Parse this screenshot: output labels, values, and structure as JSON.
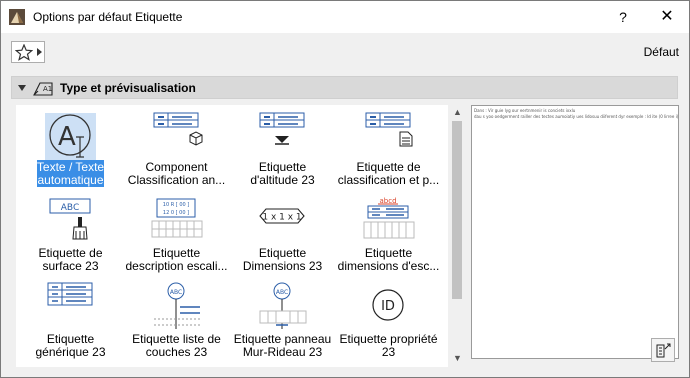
{
  "window": {
    "title": "Options par défaut Etiquette"
  },
  "title_buttons": {
    "help": "?",
    "close": "✕"
  },
  "toolbar": {
    "default_label": "Défaut"
  },
  "section": {
    "title": "Type et prévisualisation"
  },
  "tiles": [
    {
      "line1": "Texte / Texte",
      "line2": "automatique",
      "icon": "auto-text-icon",
      "selected": true
    },
    {
      "line1": "Component",
      "line2": "Classification an...",
      "icon": "component-classification-icon"
    },
    {
      "line1": "Etiquette",
      "line2": "d'altitude 23",
      "icon": "elevation-label-icon"
    },
    {
      "line1": "Etiquette de",
      "line2": "classification et p...",
      "icon": "classification-property-icon"
    },
    {
      "line1": "Etiquette de",
      "line2": "surface 23",
      "icon": "surface-label-icon"
    },
    {
      "line1": "Etiquette",
      "line2": "description escali...",
      "icon": "stair-description-icon"
    },
    {
      "line1": "Etiquette",
      "line2": "Dimensions 23",
      "icon": "dimensions-label-icon"
    },
    {
      "line1": "Etiquette",
      "line2": "dimensions d'esc...",
      "icon": "stair-dimensions-icon"
    },
    {
      "line1": "Etiquette",
      "line2": "générique 23",
      "icon": "generic-label-icon"
    },
    {
      "line1": "Etiquette liste de",
      "line2": "couches 23",
      "icon": "layer-list-icon"
    },
    {
      "line1": "Etiquette panneau",
      "line2": "Mur-Rideau 23",
      "icon": "curtain-wall-panel-icon"
    },
    {
      "line1": "Etiquette propriété",
      "line2": "23",
      "icon": "property-label-icon"
    }
  ],
  "icon_text": {
    "abc": "ABC",
    "dims": "1 x 1 x 1",
    "id": "ID",
    "abcd": "abcd",
    "stair_dims": [
      "10 R [ 00 ]",
      "12 0 [ 00 ]"
    ]
  },
  "preview": {
    "line1": "Dans : Vir guie lyg our eertnmenir is conciets ixxlu",
    "line2": "dau s yoo oedgerment railler des tectes aumoiatiy ues lidosuu diiferent dyr exemple : Id ite (0 lirree i)"
  }
}
